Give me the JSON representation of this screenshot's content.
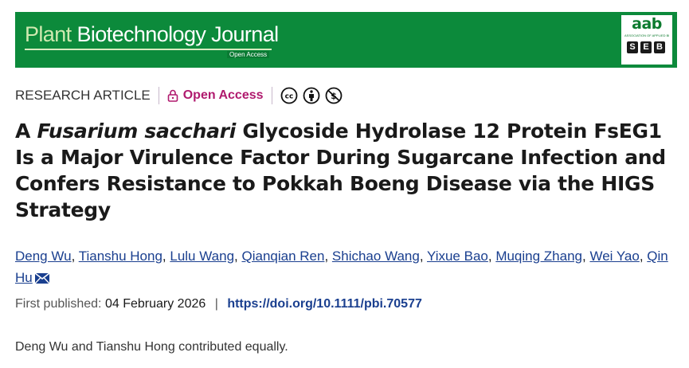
{
  "banner": {
    "journal_first": "Plant",
    "journal_rest": "Biotechnology Journal",
    "open_access_tag": "Open Access",
    "logo_text": "aab",
    "logo_subtext": "ASSOCIATION OF APPLIED BIOLOGISTS",
    "logo_letters": [
      "S",
      "E",
      "B"
    ]
  },
  "meta": {
    "article_type": "RESEARCH ARTICLE",
    "access_label": "Open Access",
    "access_color": "#b01a6e",
    "license_icons": [
      "cc-icon",
      "by-icon",
      "nc-icon"
    ]
  },
  "title": {
    "part1": "A ",
    "italic": "Fusarium sacchari",
    "part2": " Glycoside Hydrolase 12 Protein FsEG1 Is a Major Virulence Factor During Sugarcane Infection and Confers Resistance to Pokkah Boeng Disease via the HIGS Strategy"
  },
  "authors": [
    "Deng Wu",
    "Tianshu Hong",
    "Lulu Wang",
    "Qianqian Ren",
    "Shichao Wang",
    "Yixue Bao",
    "Muqing Zhang",
    "Wei Yao",
    "Qin Hu"
  ],
  "publication": {
    "label": "First published:",
    "date": "04 February 2026",
    "separator": "|",
    "doi": "https://doi.org/10.1111/pbi.70577"
  },
  "note": "Deng Wu and Tianshu Hong contributed equally.",
  "colors": {
    "banner": "#0c8a3b",
    "link": "#1a3f8f"
  }
}
